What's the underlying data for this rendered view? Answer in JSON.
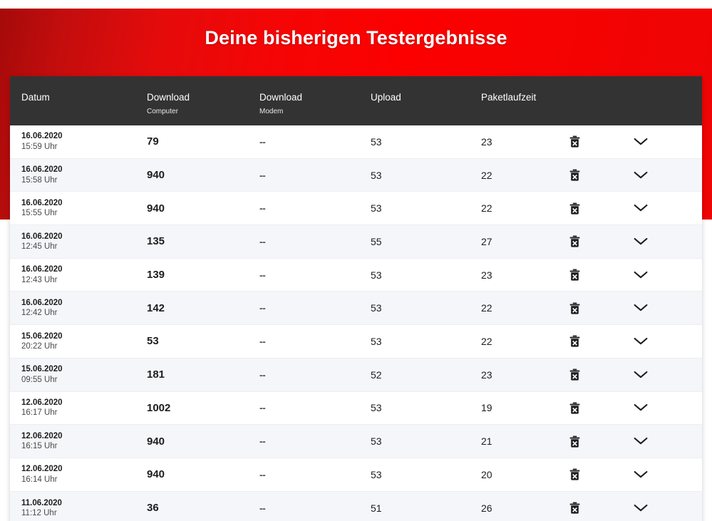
{
  "page": {
    "title": "Deine bisherigen Testergebnisse",
    "accent_red": "#f50505",
    "header_bar": "#333333",
    "row_alt": "#f5f6fa"
  },
  "table": {
    "columns": [
      {
        "label": "Datum",
        "sub": ""
      },
      {
        "label": "Download",
        "sub": "Computer"
      },
      {
        "label": "Download",
        "sub": "Modem"
      },
      {
        "label": "Upload",
        "sub": ""
      },
      {
        "label": "Paketlaufzeit",
        "sub": ""
      },
      {
        "label": "",
        "sub": ""
      },
      {
        "label": "",
        "sub": ""
      }
    ],
    "delete_icon": "trash-icon",
    "expand_icon": "chevron-down-icon",
    "rows": [
      {
        "date": "16.06.2020",
        "time": "15:59 Uhr",
        "download_computer": "79",
        "download_modem": "--",
        "upload": "53",
        "paketlaufzeit": "23"
      },
      {
        "date": "16.06.2020",
        "time": "15:58 Uhr",
        "download_computer": "940",
        "download_modem": "--",
        "upload": "53",
        "paketlaufzeit": "22"
      },
      {
        "date": "16.06.2020",
        "time": "15:55 Uhr",
        "download_computer": "940",
        "download_modem": "--",
        "upload": "53",
        "paketlaufzeit": "22"
      },
      {
        "date": "16.06.2020",
        "time": "12:45 Uhr",
        "download_computer": "135",
        "download_modem": "--",
        "upload": "55",
        "paketlaufzeit": "27"
      },
      {
        "date": "16.06.2020",
        "time": "12:43 Uhr",
        "download_computer": "139",
        "download_modem": "--",
        "upload": "53",
        "paketlaufzeit": "23"
      },
      {
        "date": "16.06.2020",
        "time": "12:42 Uhr",
        "download_computer": "142",
        "download_modem": "--",
        "upload": "53",
        "paketlaufzeit": "22"
      },
      {
        "date": "15.06.2020",
        "time": "20:22 Uhr",
        "download_computer": "53",
        "download_modem": "--",
        "upload": "53",
        "paketlaufzeit": "22"
      },
      {
        "date": "15.06.2020",
        "time": "09:55 Uhr",
        "download_computer": "181",
        "download_modem": "--",
        "upload": "52",
        "paketlaufzeit": "23"
      },
      {
        "date": "12.06.2020",
        "time": "16:17 Uhr",
        "download_computer": "1002",
        "download_modem": "--",
        "upload": "53",
        "paketlaufzeit": "19"
      },
      {
        "date": "12.06.2020",
        "time": "16:15 Uhr",
        "download_computer": "940",
        "download_modem": "--",
        "upload": "53",
        "paketlaufzeit": "21"
      },
      {
        "date": "12.06.2020",
        "time": "16:14 Uhr",
        "download_computer": "940",
        "download_modem": "--",
        "upload": "53",
        "paketlaufzeit": "20"
      },
      {
        "date": "11.06.2020",
        "time": "11:12 Uhr",
        "download_computer": "36",
        "download_modem": "--",
        "upload": "51",
        "paketlaufzeit": "26"
      }
    ]
  }
}
